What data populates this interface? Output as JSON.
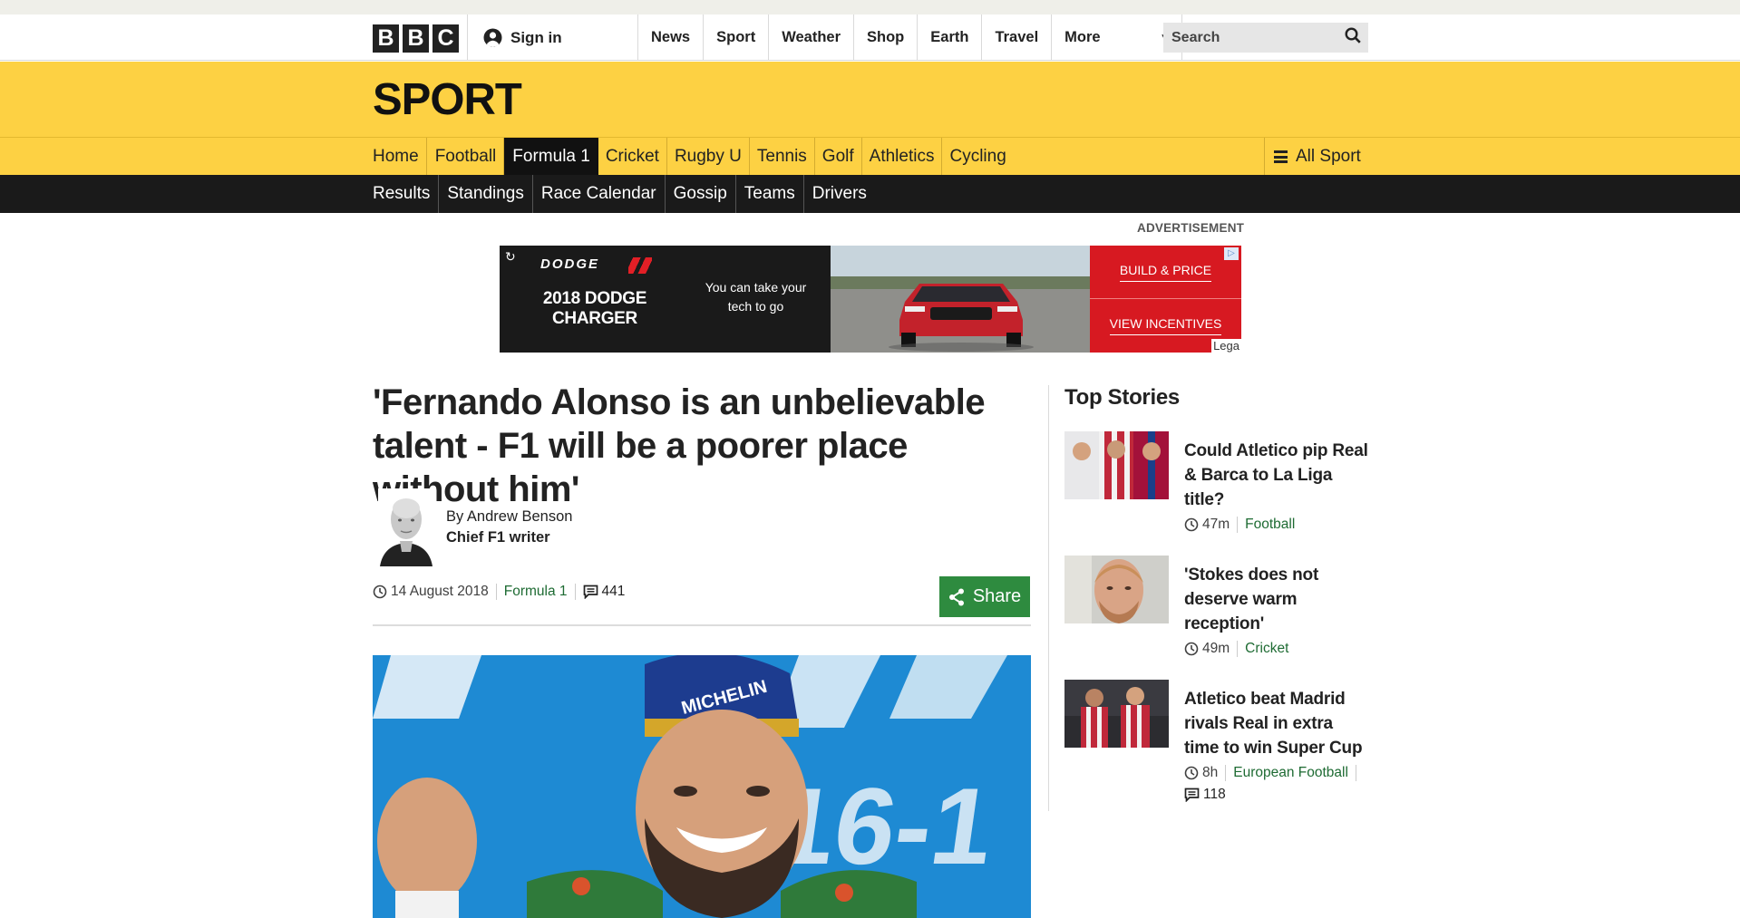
{
  "global_nav": {
    "logo_letters": [
      "B",
      "B",
      "C"
    ],
    "signin_label": "Sign in",
    "links": [
      "News",
      "Sport",
      "Weather",
      "Shop",
      "Earth",
      "Travel"
    ],
    "more_label": "More",
    "search_placeholder": "Search"
  },
  "masthead": {
    "title": "SPORT"
  },
  "sport_nav": {
    "items": [
      "Home",
      "Football",
      "Formula 1",
      "Cricket",
      "Rugby U",
      "Tennis",
      "Golf",
      "Athletics",
      "Cycling"
    ],
    "active": "Formula 1",
    "all_sport_label": "All Sport"
  },
  "sub_nav": {
    "items": [
      "Results",
      "Standings",
      "Race Calendar",
      "Gossip",
      "Teams",
      "Drivers"
    ]
  },
  "advert": {
    "label": "ADVERTISEMENT",
    "brand": "DODGE",
    "model": "2018 DODGE CHARGER",
    "tagline": "You can take your tech to go",
    "cta_primary": "BUILD & PRICE",
    "cta_secondary": "VIEW INCENTIVES",
    "legal": "Lega"
  },
  "article": {
    "headline": "'Fernando Alonso is an unbelievable talent - F1 will be a poorer place without him'",
    "author": "By Andrew Benson",
    "author_role": "Chief F1 writer",
    "date": "14 August 2018",
    "topic": "Formula 1",
    "comments": "441",
    "share_label": "Share"
  },
  "top_stories": {
    "title": "Top Stories",
    "items": [
      {
        "title": "Could Atletico pip Real & Barca to La Liga title?",
        "time": "47m",
        "topic": "Football",
        "comments": ""
      },
      {
        "title": "'Stokes does not deserve warm reception'",
        "time": "49m",
        "topic": "Cricket",
        "comments": ""
      },
      {
        "title": "Atletico beat Madrid rivals Real in extra time to win Super Cup",
        "time": "8h",
        "topic": "European Football",
        "comments": "118"
      }
    ]
  },
  "colors": {
    "sport_yellow": "#fdd143",
    "subnav_black": "#1a1a1a",
    "share_green": "#2e8b3f",
    "topic_green": "#1e6b33",
    "dodge_red": "#d71921"
  }
}
